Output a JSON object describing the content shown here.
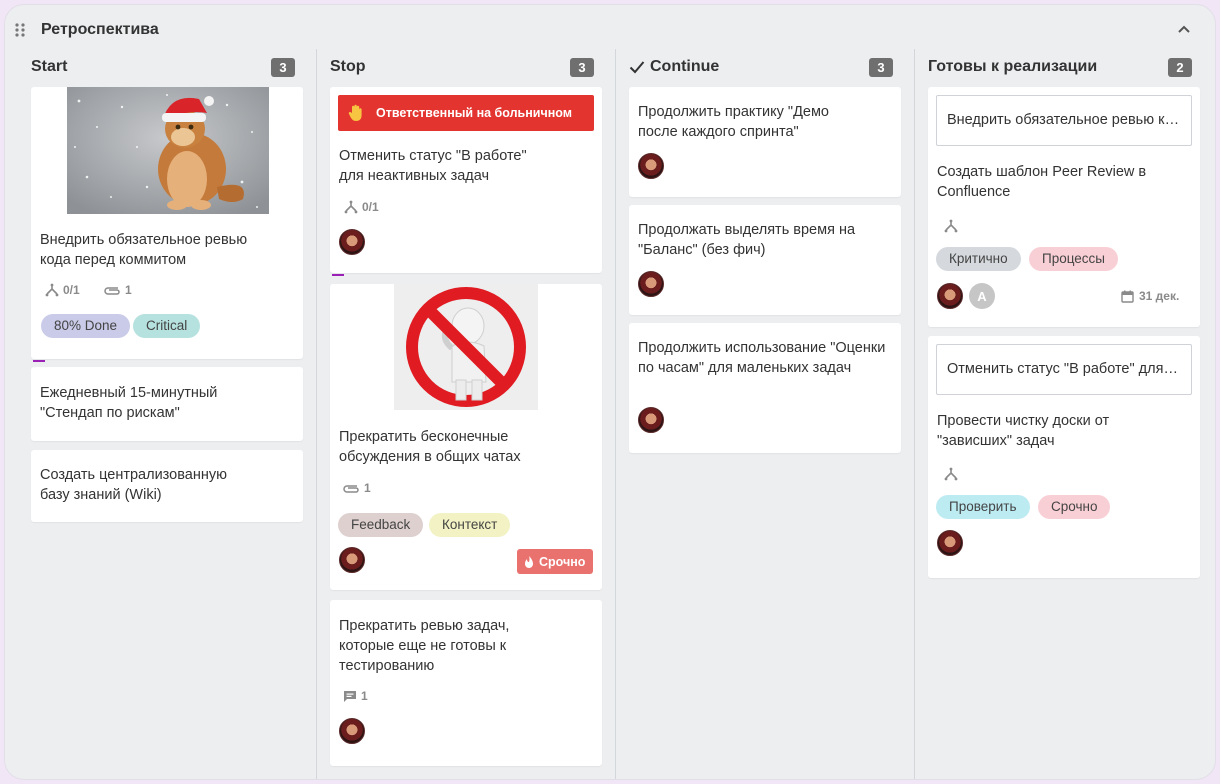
{
  "board": {
    "title": "Ретроспектива"
  },
  "columns": [
    {
      "title": "Start",
      "count": "3"
    },
    {
      "title": "Stop",
      "count": "3"
    },
    {
      "title": "Continue",
      "count": "3"
    },
    {
      "title": "Готовы к реализации",
      "count": "2"
    }
  ],
  "start": {
    "card1": {
      "text": "Внедрить обязательное ревью кода перед коммитом",
      "subtasks": "0/1",
      "attachments": "1",
      "tags": [
        "80% Done",
        "Critical"
      ]
    },
    "card2": {
      "text": "Ежедневный 15-минутный \"Стендап по рискам\""
    },
    "card3": {
      "text": "Создать централизованную базу знаний (Wiki)"
    }
  },
  "stop": {
    "card1": {
      "banner": "Ответственный на больничном",
      "text": "Отменить статус \"В работе\" для неактивных задач",
      "subtasks": "0/1"
    },
    "card2": {
      "text": "Прекратить бесконечные обсуждения в общих чатах",
      "attachments": "1",
      "tags": [
        "Feedback",
        "Контекст"
      ],
      "badge": "Срочно"
    },
    "card3": {
      "text": "Прекратить ревью задач, которые еще не готовы к тестированию",
      "comments": "1"
    }
  },
  "continue": {
    "card1": {
      "text": "Продолжить практику \"Демо после каждого спринта\""
    },
    "card2": {
      "text": "Продолжать выделять время на \"Баланс\" (без фич)"
    },
    "card3": {
      "text": "Продолжить использование \"Оценки по часам\" для маленьких задач"
    }
  },
  "ready": {
    "card1": {
      "linked": "Внедрить обязательное ревью кода перед коммитом",
      "text": "Создать шаблон Peer Review в Confluence",
      "tags": [
        "Критично",
        "Процессы"
      ],
      "avatar_letter": "A",
      "due": "31 дек."
    },
    "card2": {
      "linked": "Отменить статус \"В работе\" для неактивных задач",
      "text": "Провести чистку доски от \"зависших\" задач",
      "tags": [
        "Проверить",
        "Срочно"
      ]
    }
  },
  "colors": {
    "tag_80_done": "#c9cbe8",
    "tag_critical": "#b5e2df",
    "tag_feedback": "#ddd0ce",
    "tag_context": "#f2f2c4",
    "tag_kritichno": "#d5d9dd",
    "tag_processy": "#f9cfd6",
    "tag_proverit": "#bdebf2",
    "tag_srochno": "#f9cfd6",
    "alert": "#e3342f",
    "urgent": "#e9726f"
  }
}
